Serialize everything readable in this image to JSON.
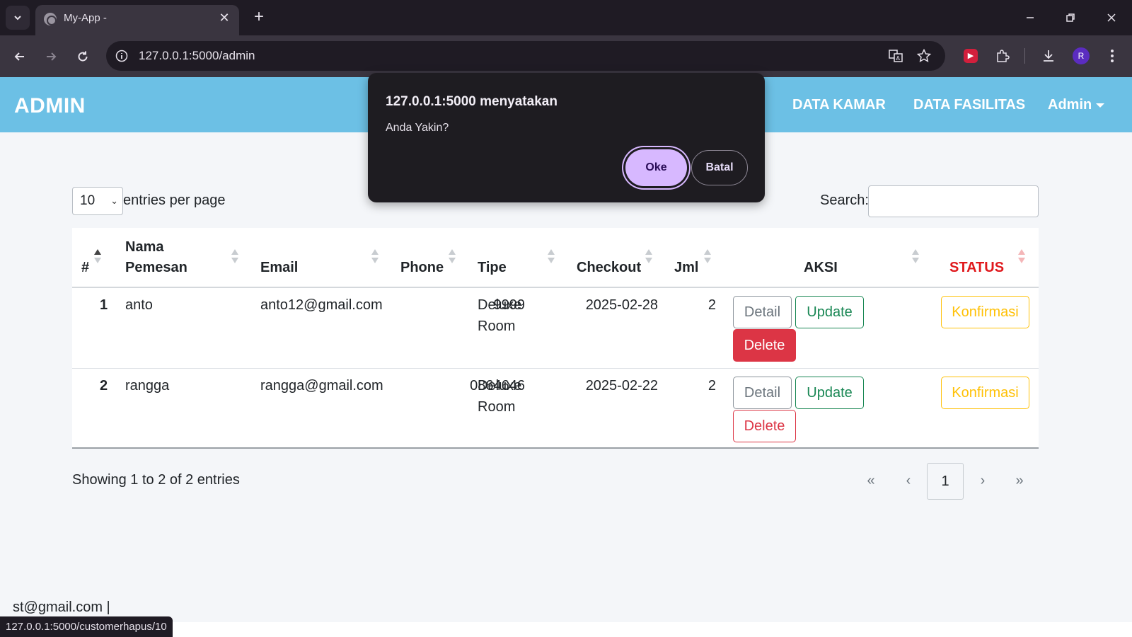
{
  "browser": {
    "tab_title": "My-App -",
    "url": "127.0.0.1:5000/admin",
    "profile_initial": "R",
    "status_url": "127.0.0.1:5000/customerhapus/10"
  },
  "navbar": {
    "brand": "ADMIN",
    "links": [
      "DATA KAMAR",
      "DATA FASILITAS"
    ],
    "dropdown_label": "Admin"
  },
  "table_controls": {
    "entries_value": "10",
    "entries_label": "entries per page",
    "search_label": "Search:",
    "search_value": ""
  },
  "table": {
    "headers": {
      "num": "#",
      "nama_line1": "Nama",
      "nama_line2": "Pemesan",
      "email": "Email",
      "phone": "Phone",
      "tipe": "Tipe",
      "checkout": "Checkout",
      "jml": "Jml",
      "aksi": "AKSI",
      "status": "STATUS"
    },
    "rows": [
      {
        "num": "1",
        "nama": "anto",
        "email": "anto12@gmail.com",
        "phone": "9999",
        "tipe_line1": "Deluxe",
        "tipe_line2": "Room",
        "checkout": "2025-02-28",
        "jml": "2",
        "detail": "Detail",
        "update": "Update",
        "delete": "Delete",
        "status": "Konfirmasi"
      },
      {
        "num": "2",
        "nama": "rangga",
        "email": "rangga@gmail.com",
        "phone": "0864646",
        "tipe_line1": "Deluxe",
        "tipe_line2": "Room",
        "checkout": "2025-02-22",
        "jml": "2",
        "detail": "Detail",
        "update": "Update",
        "delete": "Delete",
        "status": "Konfirmasi"
      }
    ]
  },
  "pagination": {
    "info": "Showing 1 to 2 of 2 entries",
    "first": "«",
    "prev": "‹",
    "current": "1",
    "next": "›",
    "last": "»"
  },
  "footer": {
    "text": "st@gmail.com |"
  },
  "dialog": {
    "title": "127.0.0.1:5000 menyatakan",
    "message": "Anda Yakin?",
    "ok_label": "Oke",
    "cancel_label": "Batal"
  },
  "colors": {
    "navbar": "#6cc0e5",
    "status_header": "#e0191d",
    "delete": "#dc3545",
    "update": "#198754",
    "konfirmasi": "#ffc107",
    "dialog_ok": "#d7b8ff"
  }
}
